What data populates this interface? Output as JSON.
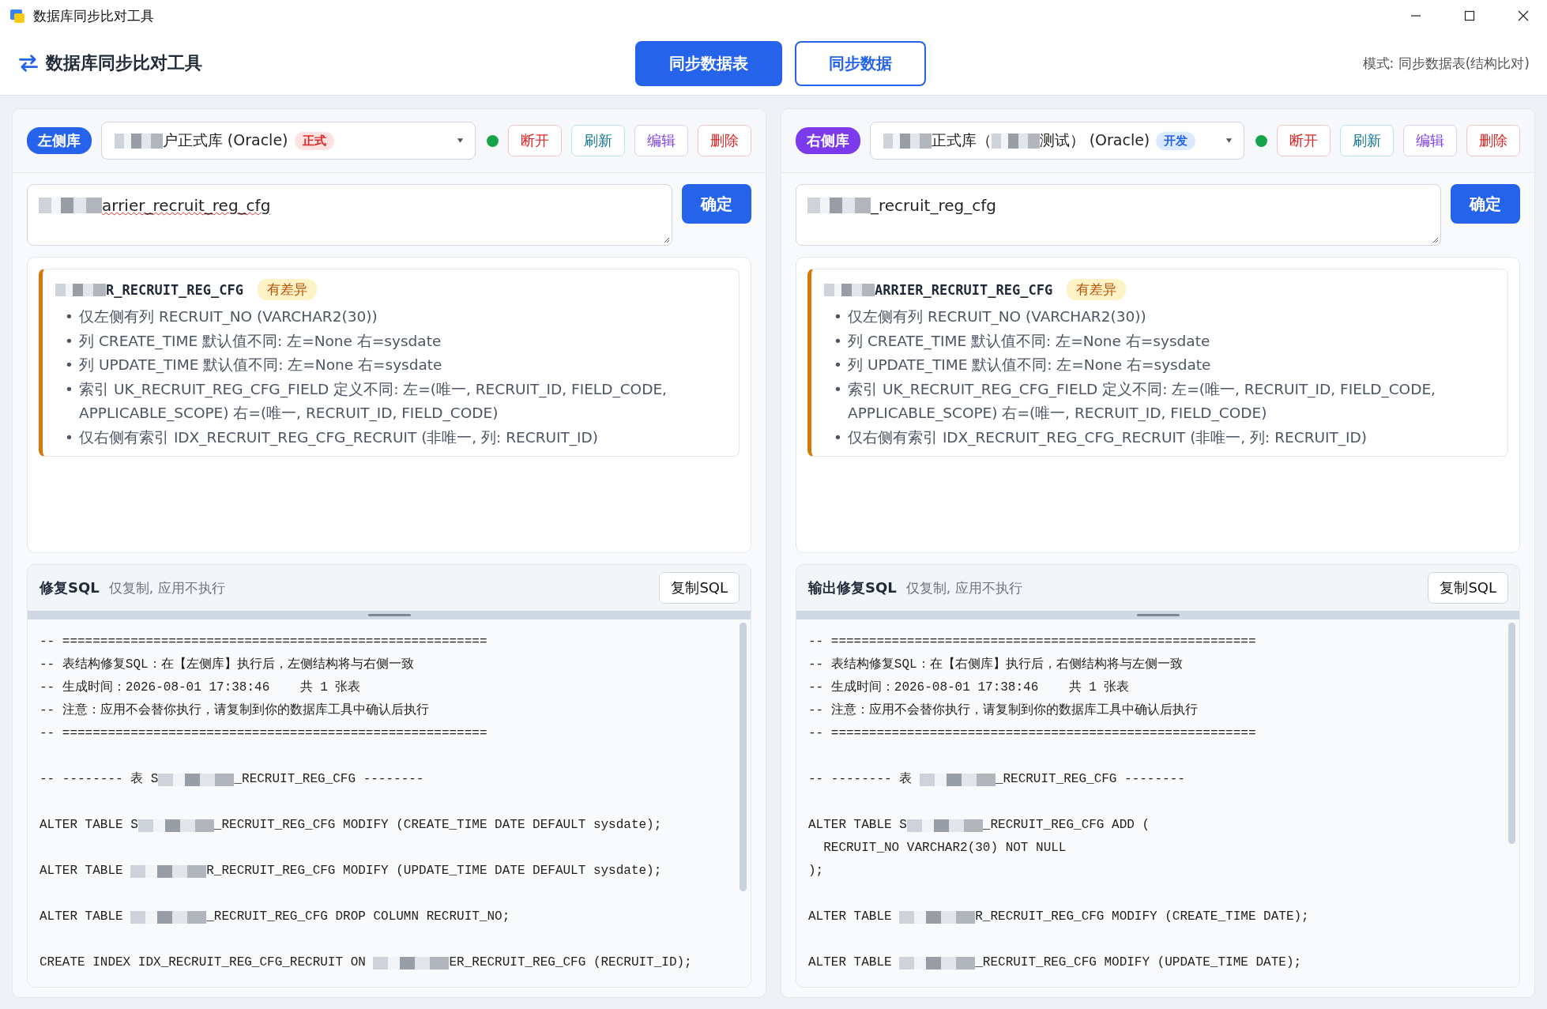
{
  "window": {
    "title": "数据库同步比对工具"
  },
  "header": {
    "title": "数据库同步比对工具",
    "tabs": [
      {
        "label": "同步数据表",
        "selected": true
      },
      {
        "label": "同步数据",
        "selected": false
      }
    ],
    "mode": "模式: 同步数据表(结构比对)"
  },
  "panels": [
    {
      "badge": {
        "label": "左侧库",
        "color": "#2563eb"
      },
      "connection": {
        "segments": [
          {
            "kind": "mask"
          },
          {
            "kind": "text",
            "text": "户正式库 (Oracle)"
          }
        ],
        "env_tag": {
          "label": "正式",
          "kind": "prod"
        }
      },
      "connected": true,
      "buttons": [
        {
          "label": "断开",
          "kind": "danger"
        },
        {
          "label": "刷新",
          "kind": "info"
        },
        {
          "label": "编辑",
          "kind": "edit"
        },
        {
          "label": "删除",
          "kind": "danger"
        }
      ],
      "table_input": {
        "segments": [
          {
            "kind": "mask"
          },
          {
            "kind": "text",
            "text": "arrier_recruit_reg_cfg"
          }
        ],
        "spell_error": true
      },
      "confirm": "确定",
      "results": [
        {
          "table": [
            {
              "kind": "mask"
            },
            {
              "kind": "text",
              "text": "R_RECRUIT_REG_CFG"
            }
          ],
          "status": "有差异",
          "items": [
            {
              "marker": "•",
              "text": "仅左侧有列 RECRUIT_NO (VARCHAR2(30))"
            },
            {
              "marker": "•",
              "text": "列 CREATE_TIME 默认值不同: 左=None 右=sysdate"
            },
            {
              "marker": "•",
              "text": "列 UPDATE_TIME 默认值不同: 左=None 右=sysdate"
            },
            {
              "marker": "•",
              "text": "索引 UK_RECRUIT_REG_CFG_FIELD 定义不同: 左=(唯一, RECRUIT_ID, FIELD_CODE, APPLICABLE_SCOPE) 右=(唯一, RECRUIT_ID, FIELD_CODE)"
            },
            {
              "marker": "•",
              "text": "仅右侧有索引 IDX_RECRUIT_REG_CFG_RECRUIT (非唯一, 列: RECRUIT_ID)"
            }
          ]
        }
      ],
      "sql": {
        "title": "修复SQL",
        "note": "仅复制, 应用不执行",
        "copy": "复制SQL",
        "lines": [
          {
            "kind": "code",
            "segments": [
              {
                "kind": "text",
                "text": "-- ========================================================"
              }
            ]
          },
          {
            "kind": "code",
            "segments": [
              {
                "kind": "text",
                "text": "-- 表结构修复SQL：在【左侧库】执行后，左侧结构将与右侧一致"
              }
            ]
          },
          {
            "kind": "code",
            "segments": [
              {
                "kind": "text",
                "text": "-- 生成时间：2026-08-01 17:38:46    共 1 张表"
              }
            ]
          },
          {
            "kind": "code",
            "segments": [
              {
                "kind": "text",
                "text": "-- 注意：应用不会替你执行，请复制到你的数据库工具中确认后执行"
              }
            ]
          },
          {
            "kind": "code",
            "segments": [
              {
                "kind": "text",
                "text": "-- ========================================================"
              }
            ]
          },
          {
            "kind": "blank"
          },
          {
            "kind": "code",
            "segments": [
              {
                "kind": "text",
                "text": "-- -------- 表 S"
              },
              {
                "kind": "mask"
              },
              {
                "kind": "text",
                "text": "_RECRUIT_REG_CFG --------"
              }
            ]
          },
          {
            "kind": "blank"
          },
          {
            "kind": "code",
            "segments": [
              {
                "kind": "text",
                "text": "ALTER TABLE S"
              },
              {
                "kind": "mask"
              },
              {
                "kind": "text",
                "text": "_RECRUIT_REG_CFG MODIFY (CREATE_TIME DATE DEFAULT sysdate);"
              }
            ]
          },
          {
            "kind": "blank"
          },
          {
            "kind": "code",
            "segments": [
              {
                "kind": "text",
                "text": "ALTER TABLE "
              },
              {
                "kind": "mask"
              },
              {
                "kind": "text",
                "text": "R_RECRUIT_REG_CFG MODIFY (UPDATE_TIME DATE DEFAULT sysdate);"
              }
            ]
          },
          {
            "kind": "blank"
          },
          {
            "kind": "code",
            "segments": [
              {
                "kind": "text",
                "text": "ALTER TABLE "
              },
              {
                "kind": "mask"
              },
              {
                "kind": "text",
                "text": "_RECRUIT_REG_CFG DROP COLUMN RECRUIT_NO;"
              }
            ]
          },
          {
            "kind": "blank"
          },
          {
            "kind": "code",
            "segments": [
              {
                "kind": "text",
                "text": "CREATE INDEX IDX_RECRUIT_REG_CFG_RECRUIT ON "
              },
              {
                "kind": "mask"
              },
              {
                "kind": "text",
                "text": "ER_RECRUIT_REG_CFG (RECRUIT_ID);"
              }
            ]
          }
        ]
      }
    },
    {
      "badge": {
        "label": "右侧库",
        "color": "#7c3aed"
      },
      "connection": {
        "segments": [
          {
            "kind": "mask"
          },
          {
            "kind": "text",
            "text": "正式库（"
          },
          {
            "kind": "mask"
          },
          {
            "kind": "text",
            "text": "测试） (Oracle)"
          }
        ],
        "env_tag": {
          "label": "开发",
          "kind": "dev"
        }
      },
      "connected": true,
      "buttons": [
        {
          "label": "断开",
          "kind": "danger"
        },
        {
          "label": "刷新",
          "kind": "info"
        },
        {
          "label": "编辑",
          "kind": "edit"
        },
        {
          "label": "删除",
          "kind": "danger"
        }
      ],
      "table_input": {
        "segments": [
          {
            "kind": "mask"
          },
          {
            "kind": "text",
            "text": "_recruit_reg_cfg"
          }
        ],
        "spell_error": false
      },
      "confirm": "确定",
      "results": [
        {
          "table": [
            {
              "kind": "mask"
            },
            {
              "kind": "text",
              "text": "ARRIER_RECRUIT_REG_CFG"
            }
          ],
          "status": "有差异",
          "items": [
            {
              "marker": "•",
              "text": "仅左侧有列 RECRUIT_NO (VARCHAR2(30))"
            },
            {
              "marker": "•",
              "text": "列 CREATE_TIME 默认值不同: 左=None 右=sysdate"
            },
            {
              "marker": "•",
              "text": "列 UPDATE_TIME 默认值不同: 左=None 右=sysdate"
            },
            {
              "marker": "•",
              "text": "索引 UK_RECRUIT_REG_CFG_FIELD 定义不同: 左=(唯一, RECRUIT_ID, FIELD_CODE, APPLICABLE_SCOPE) 右=(唯一, RECRUIT_ID, FIELD_CODE)"
            },
            {
              "marker": "•",
              "text": "仅右侧有索引 IDX_RECRUIT_REG_CFG_RECRUIT (非唯一, 列: RECRUIT_ID)"
            }
          ]
        }
      ],
      "sql": {
        "title": "输出修复SQL",
        "note": "仅复制, 应用不执行",
        "copy": "复制SQL",
        "lines": [
          {
            "kind": "code",
            "segments": [
              {
                "kind": "text",
                "text": "-- ========================================================"
              }
            ]
          },
          {
            "kind": "code",
            "segments": [
              {
                "kind": "text",
                "text": "-- 表结构修复SQL：在【右侧库】执行后，右侧结构将与左侧一致"
              }
            ]
          },
          {
            "kind": "code",
            "segments": [
              {
                "kind": "text",
                "text": "-- 生成时间：2026-08-01 17:38:46    共 1 张表"
              }
            ]
          },
          {
            "kind": "code",
            "segments": [
              {
                "kind": "text",
                "text": "-- 注意：应用不会替你执行，请复制到你的数据库工具中确认后执行"
              }
            ]
          },
          {
            "kind": "code",
            "segments": [
              {
                "kind": "text",
                "text": "-- ========================================================"
              }
            ]
          },
          {
            "kind": "blank"
          },
          {
            "kind": "code",
            "segments": [
              {
                "kind": "text",
                "text": "-- -------- 表 "
              },
              {
                "kind": "mask"
              },
              {
                "kind": "text",
                "text": "_RECRUIT_REG_CFG --------"
              }
            ]
          },
          {
            "kind": "blank"
          },
          {
            "kind": "code",
            "segments": [
              {
                "kind": "text",
                "text": "ALTER TABLE S"
              },
              {
                "kind": "mask"
              },
              {
                "kind": "text",
                "text": "_RECRUIT_REG_CFG ADD ("
              }
            ]
          },
          {
            "kind": "code",
            "segments": [
              {
                "kind": "text",
                "text": "  RECRUIT_NO VARCHAR2(30) NOT NULL"
              }
            ]
          },
          {
            "kind": "code",
            "segments": [
              {
                "kind": "text",
                "text": ");"
              }
            ]
          },
          {
            "kind": "blank"
          },
          {
            "kind": "code",
            "segments": [
              {
                "kind": "text",
                "text": "ALTER TABLE "
              },
              {
                "kind": "mask"
              },
              {
                "kind": "text",
                "text": "R_RECRUIT_REG_CFG MODIFY (CREATE_TIME DATE);"
              }
            ]
          },
          {
            "kind": "blank"
          },
          {
            "kind": "code",
            "segments": [
              {
                "kind": "text",
                "text": "ALTER TABLE "
              },
              {
                "kind": "mask"
              },
              {
                "kind": "text",
                "text": "_RECRUIT_REG_CFG MODIFY (UPDATE_TIME DATE);"
              }
            ]
          }
        ]
      }
    }
  ]
}
